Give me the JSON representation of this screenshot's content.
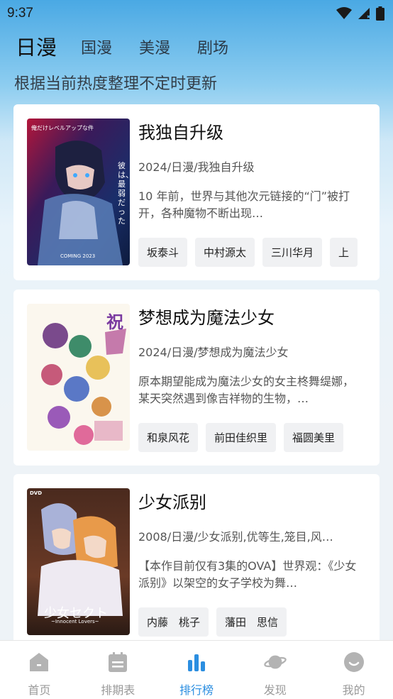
{
  "status_bar": {
    "time": "9:37"
  },
  "tabs": [
    {
      "label": "日漫",
      "active": true
    },
    {
      "label": "国漫",
      "active": false
    },
    {
      "label": "美漫",
      "active": false
    },
    {
      "label": "剧场",
      "active": false
    }
  ],
  "subtitle": "根据当前热度整理不定时更新",
  "cards": [
    {
      "title": "我独自升级",
      "meta": "2024/日漫/我独自升级",
      "description": "10 年前，世界与其他次元链接的“门”被打开，各种魔物不断出现…",
      "poster_text": [
        "俺だけレベルアップな件",
        "彼は、最弱だった",
        "COMING 2023"
      ],
      "tags": [
        "坂泰斗",
        "中村源太",
        "三川华月",
        "上"
      ]
    },
    {
      "title": "梦想成为魔法少女",
      "meta": "2024/日漫/梦想成为魔法少女",
      "description": "原本期望能成为魔法少女的女主柊舞缇娜，某天突然遇到像吉祥物的生物，…",
      "poster_text": [
        "祝"
      ],
      "tags": [
        "和泉风花",
        "前田佳织里",
        "福圆美里"
      ]
    },
    {
      "title": "少女派别",
      "meta": "2008/日漫/少女派别,优等生,笼目,风…",
      "description": "【本作目前仅有3集的OVA】世界观：《少女派别》以架空的女子学校为舞…",
      "poster_text": [
        "DVD",
        "少女セクト",
        "~Innocent Lovers~"
      ],
      "tags": [
        "内藤　桃子",
        "藩田　思信"
      ]
    }
  ],
  "bottom_nav": [
    {
      "label": "首页",
      "icon": "home-icon",
      "active": false
    },
    {
      "label": "排期表",
      "icon": "calendar-icon",
      "active": false
    },
    {
      "label": "排行榜",
      "icon": "ranking-icon",
      "active": true
    },
    {
      "label": "发现",
      "icon": "planet-icon",
      "active": false
    },
    {
      "label": "我的",
      "icon": "profile-icon",
      "active": false
    }
  ],
  "colors": {
    "accent": "#2b8ee0",
    "inactive": "#b3b3b3",
    "header_top": "#4aa9e4"
  }
}
